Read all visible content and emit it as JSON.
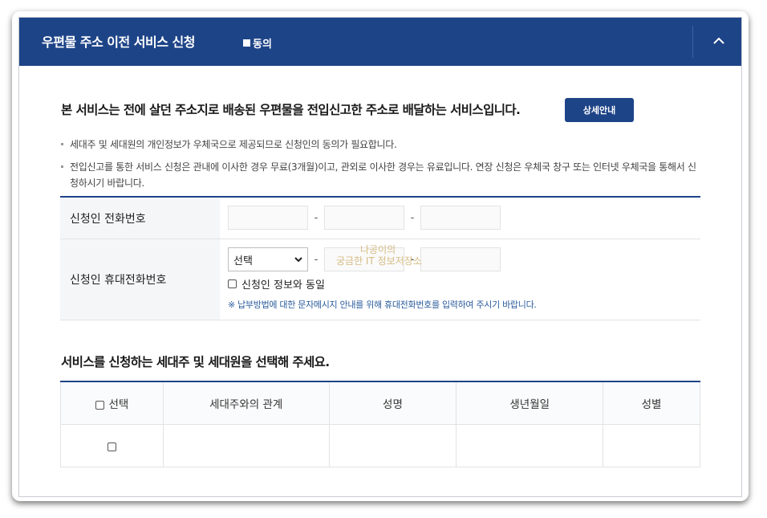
{
  "header": {
    "title": "우편물 주소 이전 서비스 신청",
    "agree_label": "동의"
  },
  "intro": {
    "text": "본 서비스는 전에 살던 주소지로 배송된 우편물을 전입신고한 주소로 배달하는 서비스입니다.",
    "detail_button": "상세안내"
  },
  "notes": [
    "세대주 및 세대원의 개인정보가 우체국으로 제공되므로 신청인의 동의가 필요합니다.",
    "전입신고를 통한 서비스 신청은 관내에 이사한 경우 무료(3개월)이고, 관외로 이사한 경우는 유료입니다. 연장 신청은 우체국 창구 또는 인터넷 우체국을 통해서 신청하시기 바랍니다."
  ],
  "form": {
    "phone_label": "신청인 전화번호",
    "mobile_label": "신청인 휴대전화번호",
    "separator": "-",
    "select_value": "선택",
    "same_as_applicant": "신청인 정보와 동일",
    "mobile_notice": "※ 납부방법에 대한 문자메시지 안내를 위해 휴대전화번호를 입력하여 주시기 바랍니다."
  },
  "watermark": {
    "line1": "나공이의",
    "line2": "궁금한 IT 정보저장소"
  },
  "members": {
    "title": "서비스를 신청하는 세대주 및 세대원을 선택해 주세요.",
    "columns": {
      "select": "선택",
      "relation": "세대주와의 관계",
      "name": "성명",
      "birth": "생년월일",
      "gender": "성별"
    }
  }
}
